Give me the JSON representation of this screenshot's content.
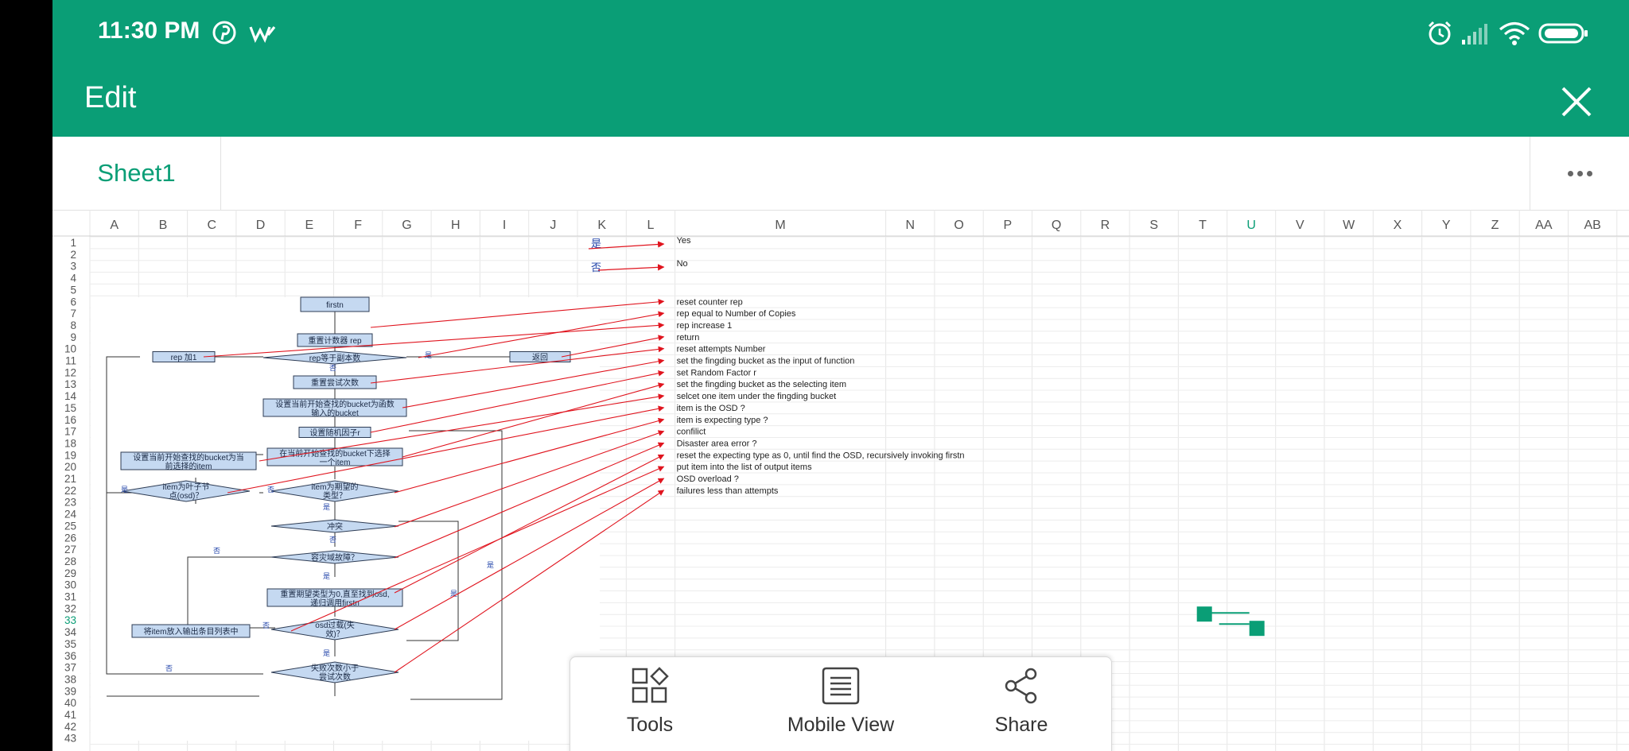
{
  "status_bar": {
    "time": "11:30 PM",
    "notification_icons": [
      "pinterest-icon",
      "w-app-icon"
    ],
    "system_icons": [
      "alarm-icon",
      "signal-icon",
      "wifi-icon",
      "battery-icon"
    ]
  },
  "app_bar": {
    "title": "Edit",
    "close_icon": "close-icon"
  },
  "sheet_tabs": {
    "active": "Sheet1",
    "more_icon": "more-horizontal-icon"
  },
  "spreadsheet": {
    "columns": [
      "A",
      "B",
      "C",
      "D",
      "E",
      "F",
      "G",
      "H",
      "I",
      "J",
      "K",
      "L",
      "M",
      "N",
      "O",
      "P",
      "Q",
      "R",
      "S",
      "T",
      "U",
      "V",
      "W",
      "X",
      "Y",
      "Z",
      "AA",
      "AB"
    ],
    "rows": [
      "1",
      "2",
      "3",
      "4",
      "5",
      "6",
      "7",
      "8",
      "9",
      "10",
      "11",
      "12",
      "13",
      "14",
      "15",
      "16",
      "17",
      "18",
      "19",
      "20",
      "21",
      "22",
      "23",
      "24",
      "25",
      "26",
      "27",
      "28",
      "29",
      "30",
      "31",
      "32",
      "33",
      "34",
      "35",
      "36",
      "37",
      "38",
      "39",
      "40",
      "41",
      "42",
      "43"
    ],
    "selected_column": "U",
    "selected_row": "33",
    "legend_cells": [
      "是",
      "否"
    ],
    "legend_labels": [
      "Yes",
      "No"
    ],
    "annotations": [
      "reset counter rep",
      "rep equal to Number of Copies",
      "rep increase 1",
      "return",
      "reset attempts Number",
      "set the fingding bucket as the input of function",
      "set Random Factor r",
      "set the fingding bucket as the selecting item",
      "selcet one item under the fingding bucket",
      "item is the OSD ?",
      "item is expecting type ?",
      "confilict",
      "Disaster area error ?",
      "reset the expecting type as 0, until find the OSD, recursively invoking firstn",
      "put item into the list of output items",
      "OSD overload ?",
      "failures less than attempts"
    ]
  },
  "flowchart": {
    "nodes": {
      "firstn": "firstn",
      "reset_rep": "重置计数器 rep",
      "rep_inc": "rep 加1",
      "rep_eq": "rep等于副本数",
      "return": "返回",
      "reset_tries": "重置尝试次数",
      "set_bucket_1": "设置当前开始查找的bucket为函数",
      "set_bucket_2": "输入的bucket",
      "set_rand": "设置随机因子r",
      "set_sel_1": "设置当前开始查找的bucket为当",
      "set_sel_2": "前选择的item",
      "select_item_1": "在当前开始查找的bucket下选择",
      "select_item_2": "一个item",
      "is_leaf_1": "item为叶子节",
      "is_leaf_2": "点(osd)？",
      "is_type_1": "item为期望的",
      "is_type_2": "类型？",
      "conflict": "冲突",
      "disaster": "容灾域故障？",
      "reset_type_1": "重置期望类型为0,直至找到osd,",
      "reset_type_2": "递归调用firstn",
      "put_item": "将item放入输出条目列表中",
      "osd_over_1": "osd过载(失",
      "osd_over_2": "效)？",
      "fail_less_1": "失败次数小于",
      "fail_less_2": "尝试次数"
    },
    "edge_yes": "是",
    "edge_no": "否"
  },
  "bottom_sheet": {
    "items": [
      {
        "label": "Tools",
        "icon": "tools-icon"
      },
      {
        "label": "Mobile View",
        "icon": "mobile-view-icon"
      },
      {
        "label": "Share",
        "icon": "share-icon"
      }
    ]
  },
  "colors": {
    "accent": "#0a9e76",
    "arrow": "#e0141e",
    "node_fill": "#c5d9f1",
    "node_stroke": "#2e3c54"
  }
}
